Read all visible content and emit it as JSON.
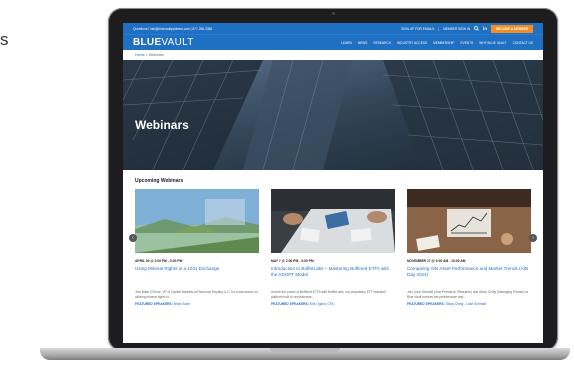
{
  "side_text": "s",
  "topbar": {
    "contact": "Questions? info@bluevaultpartners.com | 877-256-3389",
    "signup": "SIGN UP FOR EMAILS",
    "member_signin": "MEMBER SIGN IN",
    "advisor_button": "BECOME A MEMBER"
  },
  "nav": {
    "logo_bold": "BLUE",
    "logo_rest": "VAULT",
    "items": [
      "LEARN",
      "NEWS",
      "RESEARCH",
      "INDUSTRY ACCESS",
      "MEMBERSHIP",
      "EVENTS",
      "WHY BLUE VAULT",
      "CONTACT US"
    ]
  },
  "breadcrumb": {
    "home": "Home",
    "separator": ">",
    "current": "Webinars"
  },
  "hero": {
    "title": "Webinars"
  },
  "section_title": "Upcoming Webinars",
  "webinars": [
    {
      "date": "APRIL 30 @ 2:00 PM - 3:00 PM",
      "title": "Using Mineral Rights in a 1031 Exchange",
      "description": "Join Brian O'Sone, VP of Capital Markets at Resource Royalty LLC, for a discussion on utilizing mineral rights in...",
      "speakers_label": "FEATURED SPEAKERS:",
      "speakers": "Brian Sone"
    },
    {
      "date": "MAY 7 @ 2:00 PM - 3:00 PM",
      "title": "Introduction to BufferLabs – Mastering Buffered ETFs with the ADOPT Model",
      "description": "Unlock the power of Buffered ETFs with BufferLabs, our proprietary ETF research platform built to revolutionize...",
      "speakers_label": "FEATURED SPEAKERS:",
      "speakers": "Erik Ogard, CFA"
    },
    {
      "date": "NOVEMBER 17 @ 9:00 AM - 10:00 AM",
      "title": "Comparing Alts Asset Performance and Market Trends (Alts Day 2024)",
      "description": "Join Luke Schmidt (Vice President, Research) and Stacy Chitty (Managing Partner) at Blue Vault reviews the performance and...",
      "speakers_label": "FEATURED SPEAKERS:",
      "speakers": "Stacy Chitty , Luke Schmidt"
    }
  ],
  "colors": {
    "brand_blue": "#1f6fc3",
    "accent_orange": "#f68b1f"
  },
  "icons": {
    "search": "search-icon",
    "social": "linkedin-icon",
    "prev": "chevron-left-icon",
    "next": "chevron-right-icon"
  }
}
